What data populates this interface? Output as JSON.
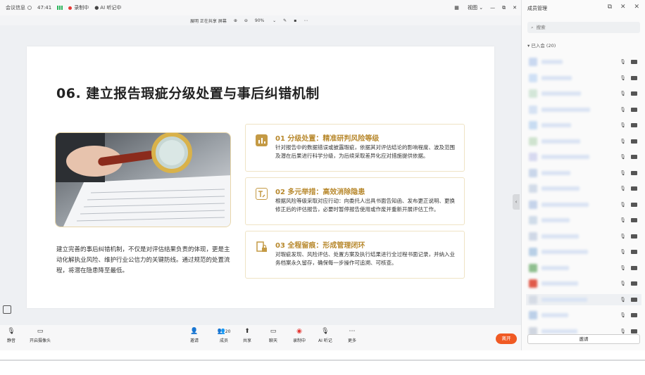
{
  "topbar": {
    "meeting_info": "会议信息",
    "timer": "47:41",
    "recording": "录制中",
    "ai_notes": "AI 听记中",
    "view_label": "视图"
  },
  "sharebar": {
    "presenter": "展明 正在共享 屏幕",
    "zoom": "90%"
  },
  "slide": {
    "title": "06. 建立报告瑕疵分级处置与事后纠错机制",
    "left_text": "建立完善的事后纠错机制，不仅是对评估结果负责的体现，更是主动化解执业风险、维护行业公信力的关键防线。通过规范的处置流程，将潜在隐患降至最低。",
    "cards": [
      {
        "title": "01 分级处置：精准研判风险等级",
        "body": "针对报告中的数据错误或披露瑕疵，依据其对评估结论的影响程度、波及范围及潜在后果进行科学分级，为后续采取差异化应对措施提供依据。",
        "icon": "bar-chart-icon"
      },
      {
        "title": "02 多元举措：高效消除隐患",
        "body": "根据风险等级采取对应行动：向委托人出具书面告知函、发布更正说明、更换修正后的评估报告，必要时暂停报告使用或作废并重新开展评估工作。",
        "icon": "edit-document-icon"
      },
      {
        "title": "03 全程留痕：形成管理闭环",
        "body": "对瑕疵发现、风险评估、处置方案及执行结果进行全过程书面记录，并纳入业务档案永久留存，确保每一步操作可追溯、可核查。",
        "icon": "lock-document-icon"
      }
    ]
  },
  "bottombar": {
    "mute": "静音",
    "camera": "开启摄像头",
    "invite": "邀请",
    "members": "成员",
    "members_count": "20",
    "share": "共享",
    "chat": "聊天",
    "recording": "录制中",
    "ai_notes": "AI 听记",
    "more": "更多",
    "leave": "离开"
  },
  "panel": {
    "title": "成员管理",
    "search_placeholder": "搜索",
    "group_label": "已入会 (20)",
    "invite_button": "邀请"
  },
  "colors": {
    "accent_gold": "#b8892e",
    "leave_orange": "#f05a24",
    "recording_red": "#e53935"
  }
}
